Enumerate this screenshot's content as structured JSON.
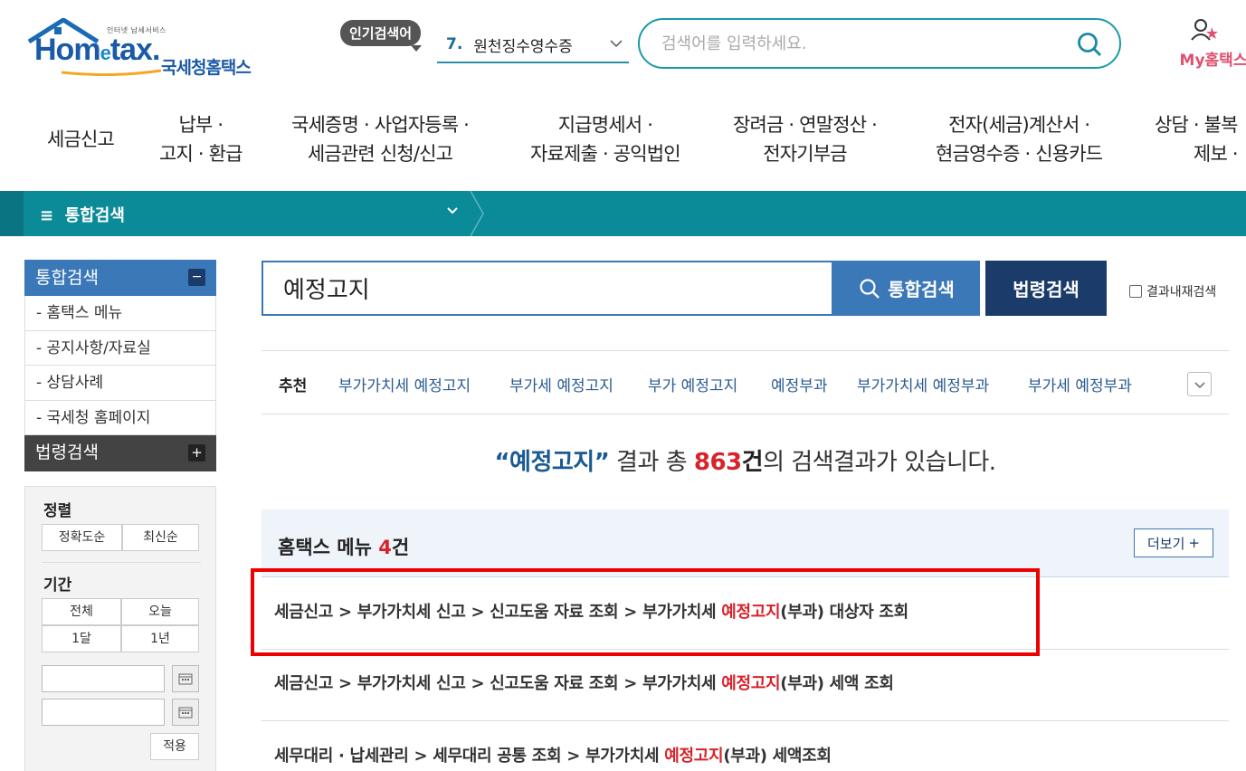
{
  "header": {
    "logo_tagline": "인터넷 납세서비스",
    "logo_brand_a": "Hom",
    "logo_brand_e": "e",
    "logo_brand_b": "tax.",
    "logo_kr": "국세청홈택스",
    "hot_badge": "인기검색어",
    "hot_num": "7.",
    "hot_text": "원천징수영수증",
    "search_placeholder": "검색어를 입력하세요.",
    "my_hometax": "My홈택스"
  },
  "gnb": [
    {
      "line1": "세금신고",
      "line2": ""
    },
    {
      "line1": "납부 ·",
      "line2": "고지 · 환급"
    },
    {
      "line1": "국세증명 · 사업자등록 ·",
      "line2": "세금관련 신청/신고"
    },
    {
      "line1": "지급명세서 ·",
      "line2": "자료제출 · 공익법인"
    },
    {
      "line1": "장려금 · 연말정산 ·",
      "line2": "전자기부금"
    },
    {
      "line1": "전자(세금)계산서 ·",
      "line2": "현금영수증 · 신용카드"
    },
    {
      "line1": "상담 · 불복",
      "line2": "제보 ·"
    }
  ],
  "breadcrumb_bar": {
    "menu_label": "통합검색"
  },
  "sidebar": {
    "group1": {
      "title": "통합검색",
      "toggle": "−"
    },
    "items": [
      "- 홈택스 메뉴",
      "- 공지사항/자료실",
      "- 상담사례",
      "- 국세청 홈페이지"
    ],
    "group2": {
      "title": "법령검색",
      "toggle": "+"
    },
    "filter": {
      "sort_title": "정렬",
      "sort_options": [
        "정확도순",
        "최신순"
      ],
      "period_title": "기간",
      "period_options": [
        "전체",
        "오늘",
        "1달",
        "1년"
      ],
      "apply": "적용"
    }
  },
  "search": {
    "query": "예정고지",
    "btn_total": "통합검색",
    "btn_law": "법령검색",
    "within_label": "결과내재검색"
  },
  "recommend": {
    "label": "추천",
    "items": [
      "부가가치세 예정고지",
      "부가세 예정고지",
      "부가 예정고지",
      "예정부과",
      "부가가치세 예정부과",
      "부가세 예정부과"
    ]
  },
  "summary": {
    "kw": "“예정고지”",
    "mid": " 결과 총 ",
    "count": "863",
    "unit": "건",
    "tail": "의 검색결과가 있습니다."
  },
  "section": {
    "title": "홈택스 메뉴 ",
    "count": "4",
    "unit": "건",
    "more": "더보기"
  },
  "results": [
    {
      "pre": "세금신고 > 부가가치세 신고 > 신고도움 자료 조회 > 부가가치세 ",
      "hl": "예정고지",
      "post": "(부과) 대상자 조회"
    },
    {
      "pre": "세금신고 > 부가가치세 신고 > 신고도움 자료 조회 > 부가가치세 ",
      "hl": "예정고지",
      "post": "(부과) 세액 조회"
    },
    {
      "pre": "세무대리 · 납세관리 > 세무대리 공통 조회 > 부가가치세 ",
      "hl": "예정고지",
      "post": "(부과) 세액조회"
    }
  ]
}
